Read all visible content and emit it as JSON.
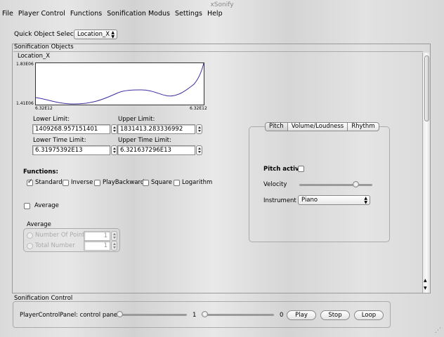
{
  "window": {
    "title": "xSonify"
  },
  "menu": [
    {
      "label": "File"
    },
    {
      "label": "Player Control"
    },
    {
      "label": "Functions"
    },
    {
      "label": "Sonification Modus"
    },
    {
      "label": "Settings"
    },
    {
      "label": "Help"
    }
  ],
  "quick_selector": {
    "label": "Quick Object Selector",
    "value": "Location_X"
  },
  "sonification_objects": {
    "title": "Sonification Objects",
    "object_name": "Location_X",
    "plot": {
      "y_max": "1.83E06",
      "y_min": "1.41E06",
      "x_min": "6.32E12",
      "x_max": "6.32E12",
      "line_color": "#3b2fa0"
    },
    "lower_limit_label": "Lower Limit:",
    "lower_limit_value": "1409268.957151401",
    "upper_limit_label": "Upper Limit:",
    "upper_limit_value": "1831413.283336992",
    "lower_time_label": "Lower Time Limit:",
    "lower_time_value": "6.31975392E13",
    "upper_time_label": "Upper Time Limit:",
    "upper_time_value": "6.321637296E13",
    "functions_label": "Functions:",
    "functions": [
      {
        "label": "Standard",
        "checked": true
      },
      {
        "label": "Inverse",
        "checked": false
      },
      {
        "label": "PlayBackward",
        "checked": false
      },
      {
        "label": "Square",
        "checked": false
      },
      {
        "label": "Logarithm",
        "checked": false
      }
    ],
    "average_checkbox": {
      "label": "Average",
      "checked": false
    },
    "average_group": {
      "title": "Average",
      "number_of_points_label": "Number Of Points",
      "number_of_points_value": "1",
      "total_number_label": "Total Number",
      "total_number_value": "1"
    },
    "tabs": [
      {
        "label": "Pitch",
        "selected": true
      },
      {
        "label": "Volume/Loudness",
        "selected": false
      },
      {
        "label": "Rhythm",
        "selected": false
      }
    ],
    "pitch_active_label": "Pitch active",
    "velocity_label": "Velocity",
    "velocity_level": 0.8,
    "instrument_label": "Instrument",
    "instrument_value": "Piano"
  },
  "sonification_control": {
    "title": "Sonification Control",
    "panel_label": "PlayerControlPanel: control panel",
    "slider1_value": "1",
    "slider1_level": 0.0,
    "slider2_value": "0",
    "slider2_level": 0.0,
    "play_label": "Play",
    "stop_label": "Stop",
    "loop_label": "Loop"
  }
}
